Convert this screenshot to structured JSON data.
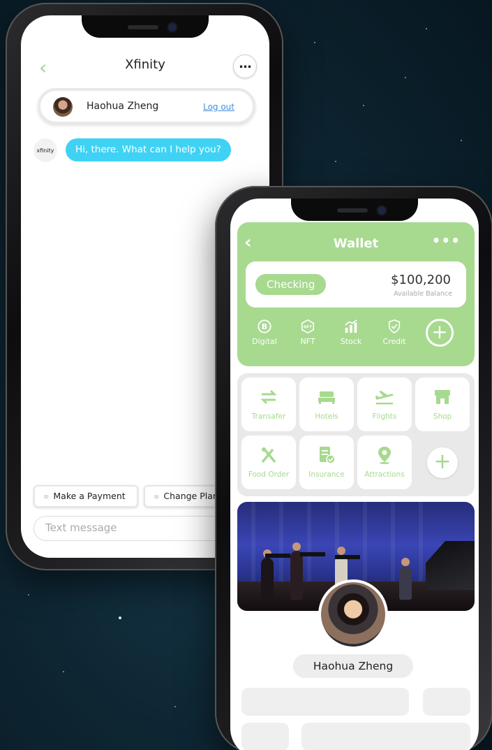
{
  "chat_app": {
    "title": "Xfinity",
    "back_icon": "chevron-left-icon",
    "more_icon": "more-horizontal-icon",
    "user": {
      "name": "Haohua Zheng",
      "logout_label": "Log out"
    },
    "messages": [
      {
        "sender": "xfinity",
        "sender_logo": "xfinity",
        "text": "Hi, there. What can I help you?"
      }
    ],
    "quick_replies": [
      {
        "label": "Make a Payment"
      },
      {
        "label": "Change Plan"
      }
    ],
    "input": {
      "placeholder": "Text message"
    },
    "colors": {
      "accent": "#9fd48c",
      "bubble": "#3fd2f4"
    }
  },
  "wallet_app": {
    "title": "Wallet",
    "back_icon": "chevron-left-icon",
    "more_icon": "more-horizontal-icon",
    "account": {
      "type": "Checking",
      "balance": "$100,200",
      "balance_caption": "Available Balance"
    },
    "assets": [
      {
        "label": "Digital",
        "icon": "bitcoin-icon"
      },
      {
        "label": "NFT",
        "icon": "nft-icon"
      },
      {
        "label": "Stock",
        "icon": "stock-chart-icon"
      },
      {
        "label": "Credit",
        "icon": "shield-check-icon"
      }
    ],
    "services": [
      {
        "label": "Transafer",
        "icon": "transfer-arrows-icon"
      },
      {
        "label": "Hotels",
        "icon": "bed-icon"
      },
      {
        "label": "Flights",
        "icon": "airplane-icon"
      },
      {
        "label": "Shop",
        "icon": "storefront-icon"
      },
      {
        "label": "Food Order",
        "icon": "fork-knife-icon"
      },
      {
        "label": "Insurance",
        "icon": "insurance-document-icon"
      },
      {
        "label": "Attractions",
        "icon": "map-pin-icon"
      }
    ],
    "profile": {
      "name": "Haohua Zheng"
    },
    "colors": {
      "accent": "#a7d98f",
      "card": "#ffffff",
      "panel": "#e9e9e9"
    }
  }
}
